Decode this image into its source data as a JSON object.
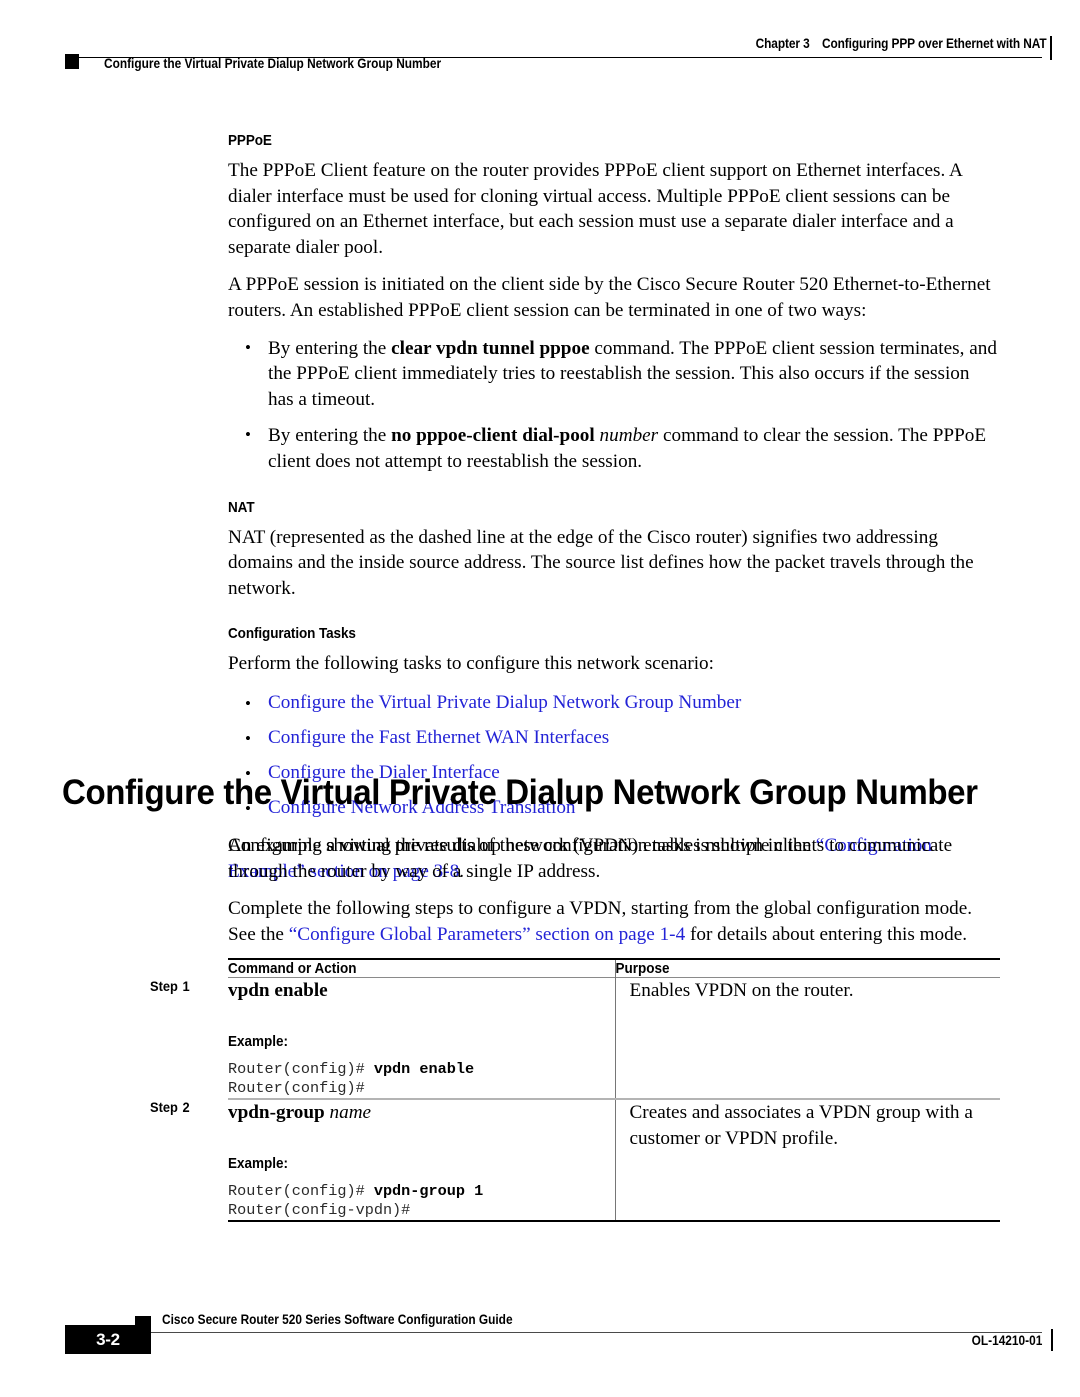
{
  "header": {
    "chapter": "Chapter 3",
    "chapter_title": "Configuring PPP over Ethernet with NAT",
    "running_head": "Configure the Virtual Private Dialup Network Group Number"
  },
  "sections": {
    "pppoe": {
      "heading": "PPPoE",
      "para1": "The PPPoE Client feature on the router provides PPPoE client support on Ethernet interfaces. A dialer interface must be used for cloning virtual access. Multiple PPPoE client sessions can be configured on an Ethernet interface, but each session must use a separate dialer interface and a separate dialer pool.",
      "para2": "A PPPoE session is initiated on the client side by the Cisco Secure Router 520 Ethernet-to-Ethernet routers. An established PPPoE client session can be terminated in one of two ways:",
      "bullet1_pre": "By entering the ",
      "bullet1_cmd": "clear vpdn tunnel pppoe",
      "bullet1_post": " command. The PPPoE client session terminates, and the PPPoE client immediately tries to reestablish the session. This also occurs if the session has a timeout.",
      "bullet2_pre": "By entering the ",
      "bullet2_cmd": "no pppoe-client dial-pool",
      "bullet2_var": "number",
      "bullet2_post": " command to clear the session. The PPPoE client does not attempt to reestablish the session."
    },
    "nat": {
      "heading": "NAT",
      "para1": "NAT (represented as the dashed line at the edge of the Cisco router) signifies two addressing domains and the inside source address. The source list defines how the packet travels through the network."
    },
    "config_tasks": {
      "heading": "Configuration Tasks",
      "intro": "Perform the following tasks to configure this network scenario:",
      "links": [
        "Configure the Virtual Private Dialup Network Group Number",
        "Configure the Fast Ethernet WAN Interfaces",
        "Configure the Dialer Interface",
        "Configure Network Address Translation"
      ],
      "outro_pre": "An example showing the results of these configuration tasks is shown in the ",
      "outro_link": "“Configuration Example” section on page 3-8",
      "outro_post": "."
    }
  },
  "main": {
    "title": "Configure the Virtual Private Dialup Network Group Number",
    "para1": "Configuring a virtual private dialup network (VPDN) enables multiple clients to communicate through the router by way of a single IP address.",
    "para2_pre": "Complete the following steps to configure a VPDN, starting from the global configuration mode. See the ",
    "para2_link": "“Configure Global Parameters” section on page 1-4",
    "para2_post": " for details about entering this mode."
  },
  "table": {
    "headers": {
      "command": "Command or Action",
      "purpose": "Purpose"
    },
    "rows": [
      {
        "step_label": "Step",
        "step_number": "1",
        "command": "vpdn enable",
        "command_var": "",
        "example_label": "Example:",
        "code_line1_prompt": "Router(config)# ",
        "code_line1_cmd": "vpdn enable",
        "code_line2": "Router(config)#",
        "purpose": "Enables VPDN on the router."
      },
      {
        "step_label": "Step",
        "step_number": "2",
        "command": "vpdn-group",
        "command_var": "name",
        "example_label": "Example:",
        "code_line1_prompt": "Router(config)# ",
        "code_line1_cmd": "vpdn-group 1",
        "code_line2": "Router(config-vpdn)#",
        "purpose": "Creates and associates a VPDN group with a customer or VPDN profile."
      }
    ]
  },
  "footer": {
    "guide_title": "Cisco Secure Router 520 Series Software Configuration Guide",
    "page_number": "3-2",
    "doc_number": "OL-14210-01"
  },
  "colors": {
    "link": "#2323d6",
    "text": "#000000",
    "rule": "#000000"
  }
}
